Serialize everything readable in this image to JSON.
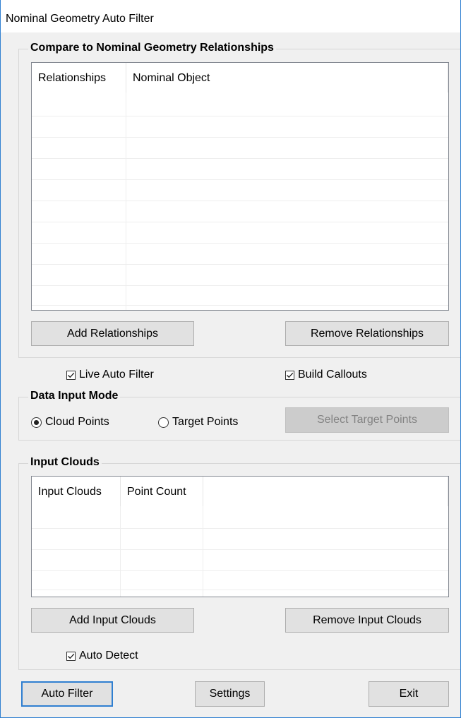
{
  "window": {
    "title": "Nominal Geometry Auto Filter"
  },
  "relationships_group": {
    "legend": "Compare to Nominal Geometry Relationships",
    "columns": [
      "Relationships",
      "Nominal Object"
    ],
    "add_label": "Add Relationships",
    "remove_label": "Remove Relationships"
  },
  "options": {
    "live_auto_filter": {
      "label": "Live Auto Filter",
      "checked": true
    },
    "build_callouts": {
      "label": "Build Callouts",
      "checked": true
    }
  },
  "data_input_mode": {
    "legend": "Data Input Mode",
    "cloud_points_label": "Cloud Points",
    "target_points_label": "Target Points",
    "selected": "Cloud Points",
    "select_target_label": "Select Target Points"
  },
  "input_clouds_group": {
    "legend": "Input Clouds",
    "columns": [
      "Input Clouds",
      "Point Count"
    ],
    "add_label": "Add Input Clouds",
    "remove_label": "Remove Input Clouds",
    "auto_detect": {
      "label": "Auto Detect",
      "checked": true
    }
  },
  "footer": {
    "auto_filter_label": "Auto Filter",
    "settings_label": "Settings",
    "exit_label": "Exit"
  },
  "colors": {
    "accent": "#2f7fd1",
    "background": "#f0f0f0",
    "button": "#e1e1e1"
  }
}
